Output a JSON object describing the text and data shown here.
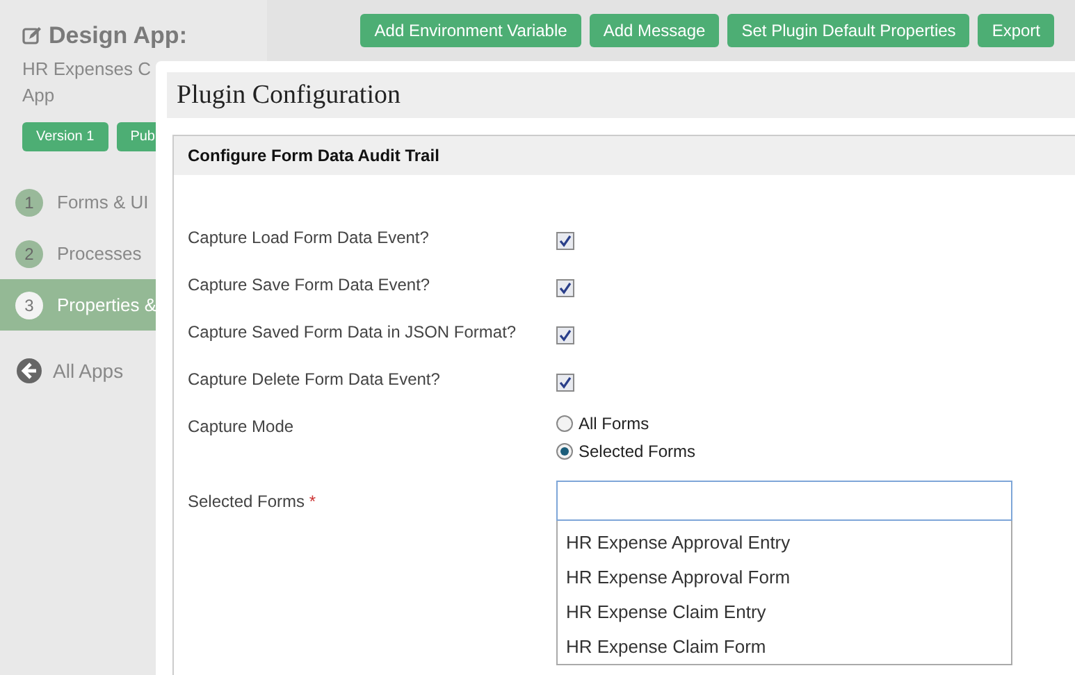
{
  "sidebar": {
    "title": "Design App:",
    "app_name_lines": [
      "HR Expenses C",
      "App"
    ],
    "badges": [
      "Version 1",
      "Pub"
    ],
    "items": [
      {
        "number": "1",
        "label": "Forms & UI",
        "selected": false
      },
      {
        "number": "2",
        "label": "Processes",
        "selected": false
      },
      {
        "number": "3",
        "label": "Properties &",
        "selected": true
      }
    ],
    "back_link": "All Apps"
  },
  "toolbar": {
    "buttons": [
      "Add Environment Variable",
      "Add Message",
      "Set Plugin Default Properties",
      "Export"
    ]
  },
  "dialog": {
    "title": "Plugin Configuration",
    "section_title": "Configure Form Data Audit Trail",
    "fields": [
      {
        "kind": "checkbox",
        "label": "Capture Load Form Data Event?",
        "checked": true
      },
      {
        "kind": "checkbox",
        "label": "Capture Save Form Data Event?",
        "checked": true
      },
      {
        "kind": "checkbox",
        "label": "Capture Saved Form Data in JSON Format?",
        "checked": true
      },
      {
        "kind": "checkbox",
        "label": "Capture Delete Form Data Event?",
        "checked": true
      },
      {
        "kind": "radio",
        "label": "Capture Mode",
        "options": [
          {
            "label": "All Forms",
            "selected": false
          },
          {
            "label": "Selected Forms",
            "selected": true
          }
        ]
      },
      {
        "kind": "multiselect",
        "label": "Selected Forms",
        "required_mark": "*",
        "options": [
          "HR Expense Approval Entry",
          "HR Expense Approval Form",
          "HR Expense Claim Entry",
          "HR Expense Claim Form"
        ]
      }
    ]
  }
}
